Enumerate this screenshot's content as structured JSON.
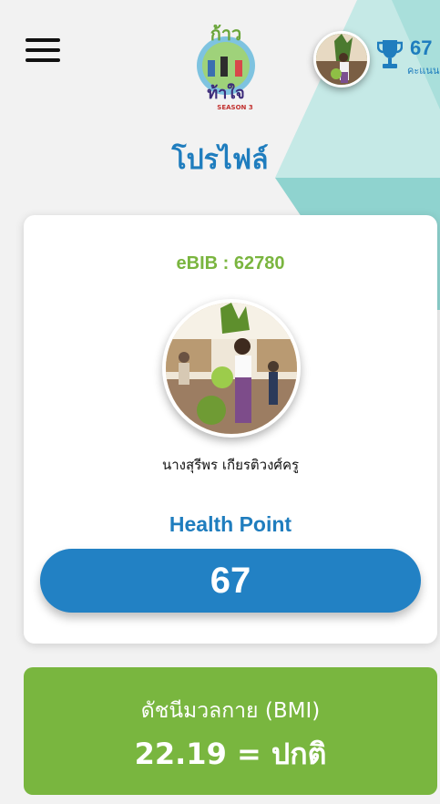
{
  "header": {
    "menu_icon": "hamburger-menu-icon",
    "logo": {
      "line1": "ก้าว",
      "line2": "ท้าใจ",
      "season": "SEASON 3"
    },
    "score": {
      "value": "67",
      "unit": "คะแนน",
      "icon": "trophy-icon"
    }
  },
  "page": {
    "title": "โปรไฟล์"
  },
  "profile": {
    "ebib": "eBIB : 62780",
    "name": "นางสุรีพร เกียรติวงศ์ครู",
    "health_point_label": "Health Point",
    "health_point_value": "67"
  },
  "bmi": {
    "label": "ดัชนีมวลกาย (BMI)",
    "value": "22.19 = ปกติ"
  },
  "colors": {
    "primary": "#1f7dbe",
    "green": "#79b63f",
    "teal": "#8fd3cf"
  }
}
